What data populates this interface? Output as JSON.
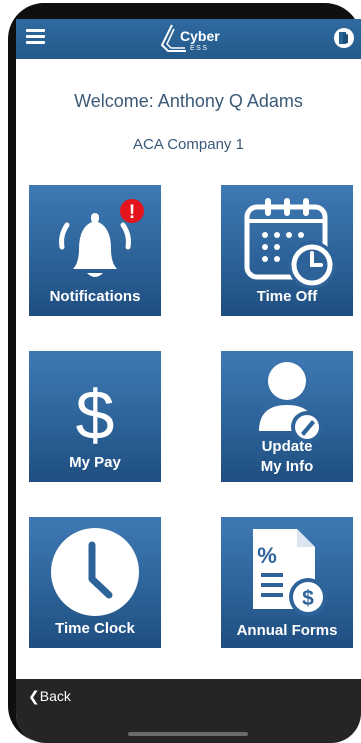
{
  "header": {
    "menu_icon": "hamburger-menu-icon",
    "logo_text": "Cyber",
    "logo_subtext": "ESS",
    "logout_icon": "logout-door-icon"
  },
  "welcome": {
    "text": "Welcome:  Anthony Q Adams",
    "company": "ACA Company 1"
  },
  "tiles": [
    {
      "label": "Notifications",
      "icon": "bell-icon",
      "badge": "!"
    },
    {
      "label": "Time Off",
      "icon": "calendar-clock-icon"
    },
    {
      "label": "My Pay",
      "icon": "dollar-icon"
    },
    {
      "label": "Update",
      "label2": "My Info",
      "icon": "user-edit-icon"
    },
    {
      "label": "Time Clock",
      "icon": "clock-icon"
    },
    {
      "label": "Annual Forms",
      "icon": "document-dollar-icon"
    }
  ],
  "footer": {
    "back_label": "Back"
  },
  "colors": {
    "header": "#2a6496",
    "tile": "#2d6399",
    "badge": "#e3141b",
    "text": "#3b5a78",
    "footer": "#252525"
  }
}
